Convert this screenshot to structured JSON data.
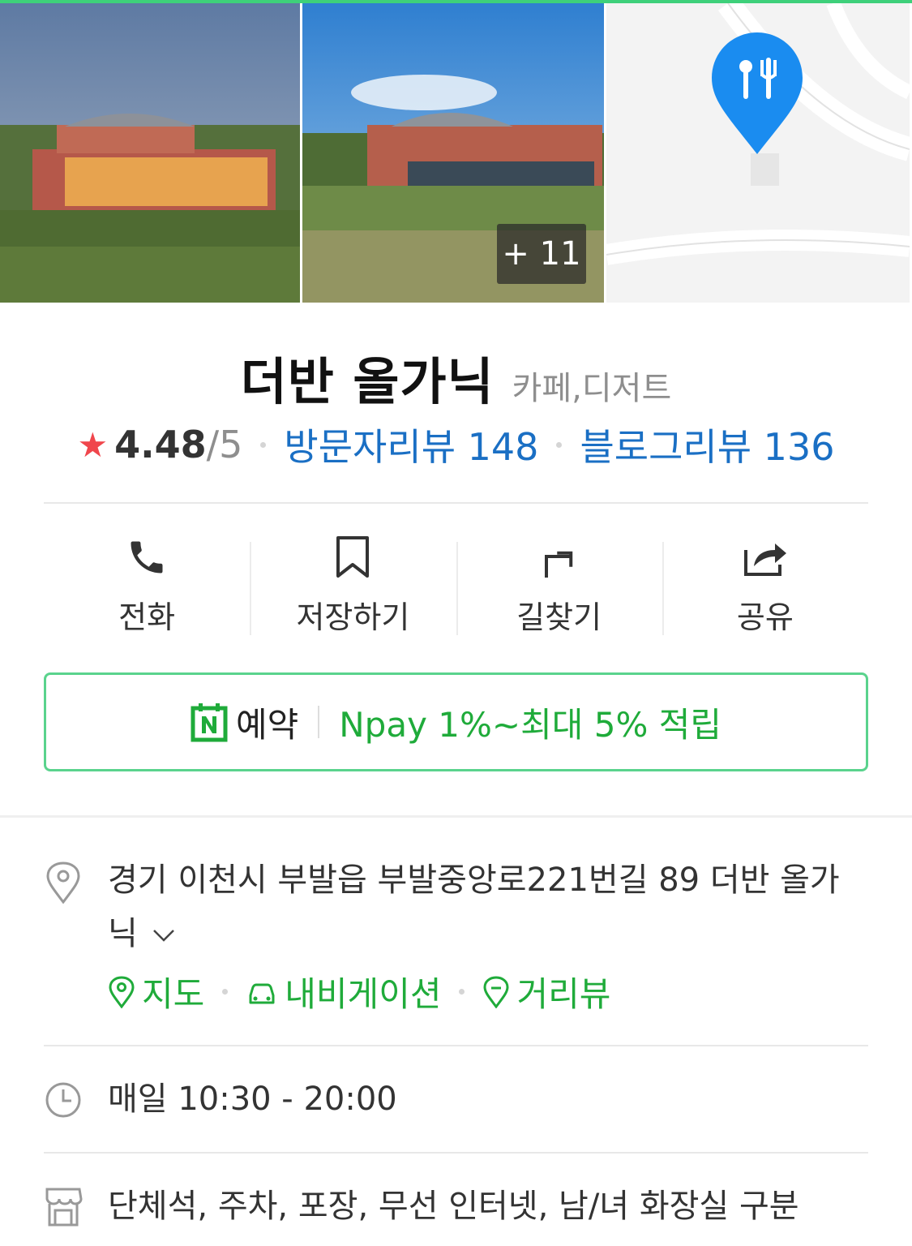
{
  "photos": {
    "more_count": "+ 11"
  },
  "place": {
    "name": "더반 올가닉",
    "category": "카페,디저트"
  },
  "rating": {
    "star": "★",
    "score": "4.48",
    "max": "/5",
    "visitor_reviews": "방문자리뷰 148",
    "blog_reviews": "블로그리뷰 136"
  },
  "actions": {
    "call": "전화",
    "save": "저장하기",
    "directions": "길찾기",
    "share": "공유"
  },
  "booking": {
    "label": "예약",
    "promo": "Npay 1%~최대 5% 적립"
  },
  "address": {
    "text": "경기 이천시 부발읍 부발중앙로221번길 89 더반 올가닉",
    "links": {
      "map": "지도",
      "navigation": "내비게이션",
      "street_view": "거리뷰"
    }
  },
  "hours": {
    "text": "매일 10:30 - 20:00"
  },
  "amenities": {
    "text": "단체석, 주차, 포장, 무선 인터넷, 남/녀 화장실 구분"
  },
  "colors": {
    "accent_green": "#1fab3a",
    "link_blue": "#1a6fc4",
    "star_red": "#f0464c",
    "map_pin_blue": "#1a8cf0"
  }
}
